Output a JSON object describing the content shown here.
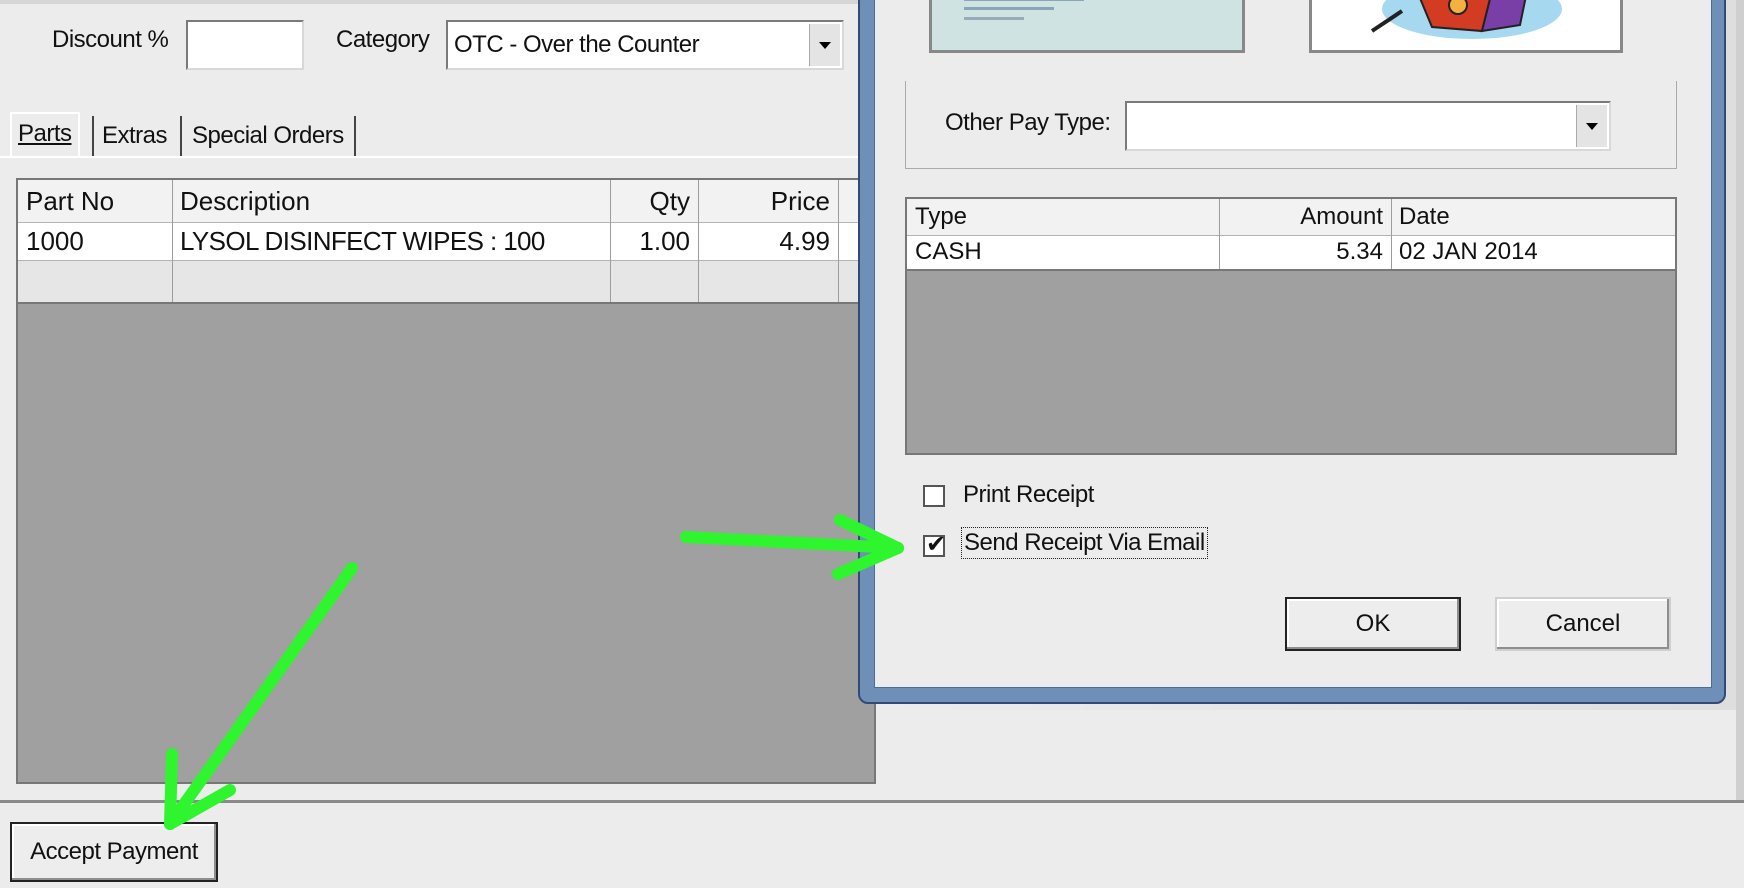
{
  "main": {
    "discount_label": "Discount %",
    "discount_value": "",
    "category_label": "Category",
    "category_value": "OTC - Over the Counter",
    "tabs": [
      {
        "label": "Parts"
      },
      {
        "label": "Extras"
      },
      {
        "label": "Special Orders"
      }
    ],
    "parts_table": {
      "headers": [
        "Part No",
        "Description",
        "Qty",
        "Price"
      ],
      "rows": [
        [
          "1000",
          "LYSOL DISINFECT WIPES : 100",
          "1.00",
          "4.99"
        ]
      ]
    },
    "accept_payment_label": "Accept Payment"
  },
  "dialog": {
    "other_pay_type_label": "Other Pay Type:",
    "other_pay_type_value": "",
    "payments_table": {
      "headers": [
        "Type",
        "Amount",
        "Date"
      ],
      "rows": [
        [
          "CASH",
          "5.34",
          "02 JAN 2014"
        ]
      ]
    },
    "print_receipt_label": "Print Receipt",
    "print_receipt_checked": false,
    "send_email_label": "Send Receipt Via Email",
    "send_email_checked": true,
    "ok_label": "OK",
    "cancel_label": "Cancel"
  },
  "colors": {
    "annotation_arrow": "#2ef52e",
    "window_frame": "#5f7fa8",
    "grid_empty": "#a0a0a0"
  }
}
